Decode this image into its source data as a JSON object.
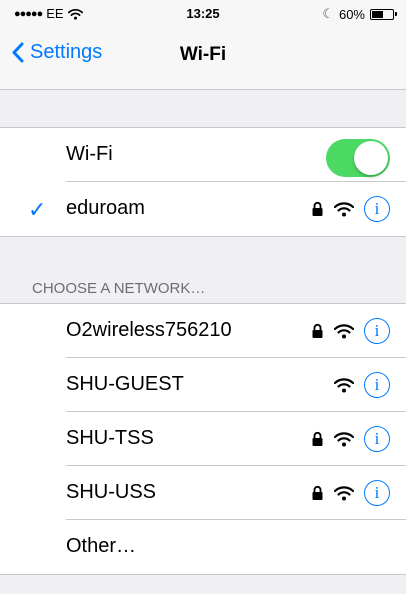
{
  "status_bar": {
    "carrier": "EE",
    "time": "13:25",
    "battery_percent": "60%",
    "battery_level": 0.6
  },
  "nav": {
    "back_label": "Settings",
    "title": "Wi-Fi"
  },
  "wifi_toggle": {
    "label": "Wi-Fi",
    "on": true
  },
  "connected": {
    "name": "eduroam",
    "secured": true
  },
  "section_header": "CHOOSE A NETWORK…",
  "networks": [
    {
      "name": "O2wireless756210",
      "secured": true
    },
    {
      "name": "SHU-GUEST",
      "secured": false
    },
    {
      "name": "SHU-TSS",
      "secured": true
    },
    {
      "name": "SHU-USS",
      "secured": true
    }
  ],
  "other_label": "Other…",
  "colors": {
    "accent": "#007aff",
    "toggle_on": "#4cd964",
    "background": "#efeff4"
  },
  "icons": [
    "back-chevron-icon",
    "checkmark-icon",
    "lock-icon",
    "wifi-signal-icon",
    "info-icon",
    "moon-icon"
  ]
}
